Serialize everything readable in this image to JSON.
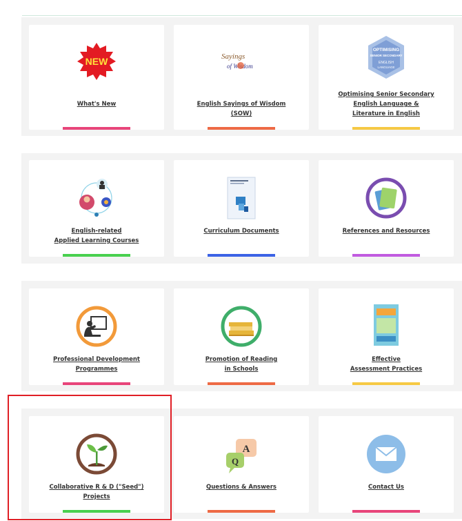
{
  "cards": [
    {
      "icon": "new-badge-icon",
      "lines": [
        "What's New"
      ],
      "bar_color": "#e8457a"
    },
    {
      "icon": "sayings-of-wisdom-logo",
      "lines": [
        "English Sayings of Wisdom",
        "(SOW)"
      ],
      "bar_color": "#ee6a45"
    },
    {
      "icon": "optimising-senior-secondary-book-icon",
      "lines": [
        "Optimising Senior Secondary",
        "English Language &",
        "Literature in English"
      ],
      "bar_color": "#f6c944"
    },
    {
      "icon": "applied-learning-people-icon",
      "lines": [
        "English-related",
        "Applied Learning Courses"
      ],
      "bar_color": "#49d04f"
    },
    {
      "icon": "curriculum-document-icon",
      "lines": [
        "Curriculum Documents"
      ],
      "bar_color": "#3c63e6"
    },
    {
      "icon": "references-books-icon",
      "lines": [
        "References and Resources"
      ],
      "bar_color": "#c15be0"
    },
    {
      "icon": "teacher-presentation-icon",
      "lines": [
        "Professional Development",
        "Programmes"
      ],
      "bar_color": "#e8457a"
    },
    {
      "icon": "reading-books-icon",
      "lines": [
        "Promotion of Reading",
        "in Schools"
      ],
      "bar_color": "#ee6a45"
    },
    {
      "icon": "assessment-booklet-icon",
      "lines": [
        "Effective",
        "Assessment Practices"
      ],
      "bar_color": "#f6c944"
    },
    {
      "icon": "seedling-icon",
      "lines": [
        "Collaborative R & D (\"Seed\")",
        "Projects"
      ],
      "bar_color": "#49d04f"
    },
    {
      "icon": "question-answer-bubbles-icon",
      "lines": [
        "Questions & Answers"
      ],
      "bar_color": "#ee6a45"
    },
    {
      "icon": "envelope-icon",
      "lines": [
        "Contact Us"
      ],
      "bar_color": "#e8457a"
    }
  ],
  "icon_text": {
    "new_badge": "NEW",
    "sow_logo": [
      "Sayings",
      "of Wisdom"
    ],
    "optimising_cover": [
      "OPTIMISING",
      "SENIOR SECONDARY",
      "ENGLISH",
      "LANGUAGE"
    ],
    "qa_letters": [
      "Q",
      "A"
    ]
  }
}
